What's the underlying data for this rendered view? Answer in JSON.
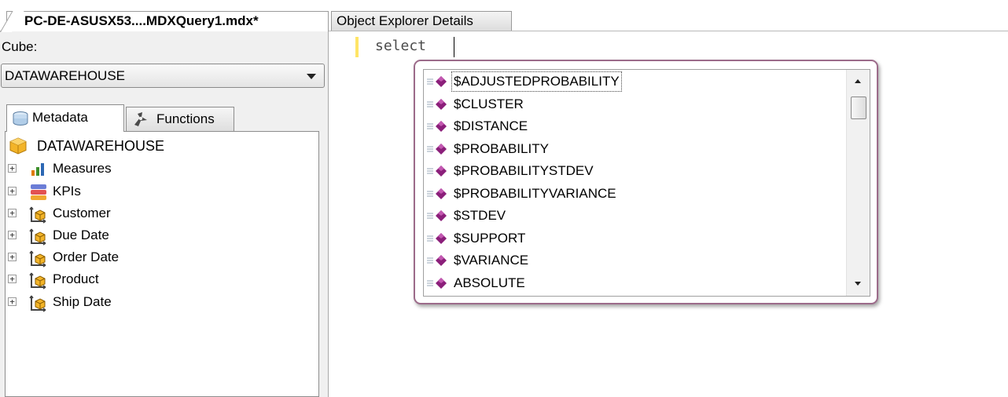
{
  "tabs": {
    "active": "PC-DE-ASUSX53....MDXQuery1.mdx*",
    "inactive": "Object Explorer Details"
  },
  "left_pane": {
    "cube_label": "Cube:",
    "cube_selected": "DATAWAREHOUSE",
    "panel_tabs": {
      "metadata": "Metadata",
      "functions": "Functions"
    },
    "tree": {
      "root": "DATAWAREHOUSE",
      "items": [
        {
          "label": "Measures",
          "icon": "measures-icon"
        },
        {
          "label": "KPIs",
          "icon": "kpis-icon"
        },
        {
          "label": "Customer",
          "icon": "dimension-icon"
        },
        {
          "label": "Due Date",
          "icon": "dimension-icon"
        },
        {
          "label": "Order Date",
          "icon": "dimension-icon"
        },
        {
          "label": "Product",
          "icon": "dimension-icon"
        },
        {
          "label": "Ship Date",
          "icon": "dimension-icon"
        }
      ]
    }
  },
  "editor": {
    "code": "select"
  },
  "intellisense": {
    "items": [
      "$ADJUSTEDPROBABILITY",
      "$CLUSTER",
      "$DISTANCE",
      "$PROBABILITY",
      "$PROBABILITYSTDEV",
      "$PROBABILITYVARIANCE",
      "$STDEV",
      "$SUPPORT",
      "$VARIANCE",
      "ABSOLUTE"
    ],
    "selected_index": 0
  },
  "colors": {
    "popup_border": "#9c6b8a",
    "function_icon": "#8b1f7a",
    "cube_icon": "#f3b428",
    "line_marker": "#ffe566"
  }
}
